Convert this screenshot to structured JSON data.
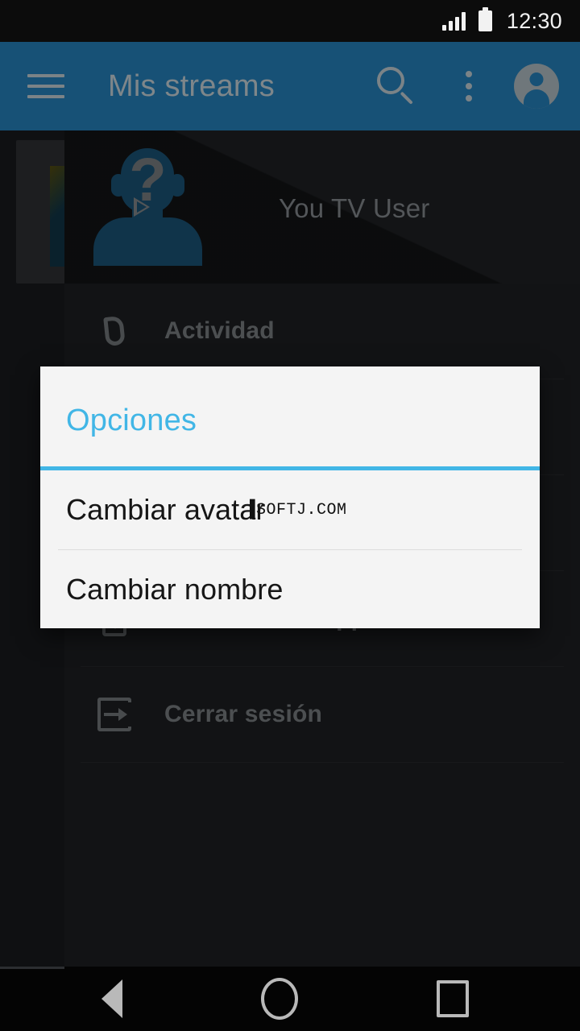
{
  "status_bar": {
    "time": "12:30",
    "signal_icon": "signal-bars-icon",
    "battery_icon": "battery-full-icon"
  },
  "app_bar": {
    "title": "Mis streams",
    "menu_icon": "hamburger-menu-icon",
    "search_icon": "search-icon",
    "overflow_icon": "overflow-menu-icon",
    "account_icon": "account-circle-icon",
    "background_color": "#175176"
  },
  "drawer": {
    "username": "You TV User",
    "avatar_icon": "user-avatar-question-icon",
    "items": [
      {
        "label": "Actividad",
        "icon": "flame-icon"
      },
      {
        "label": "Version de la app",
        "icon": "phone-download-icon"
      },
      {
        "label": "Cerrar sesión",
        "icon": "logout-icon"
      }
    ]
  },
  "dialog": {
    "title": "Opciones",
    "accent_color": "#41b6e6",
    "options": [
      {
        "label": "Cambiar avatar"
      },
      {
        "label": "Cambiar nombre"
      }
    ]
  },
  "watermark": {
    "text": "SOFTJ.COM"
  },
  "nav_bar": {
    "back_icon": "back-triangle-icon",
    "home_icon": "home-circle-icon",
    "recents_icon": "recents-square-icon"
  }
}
